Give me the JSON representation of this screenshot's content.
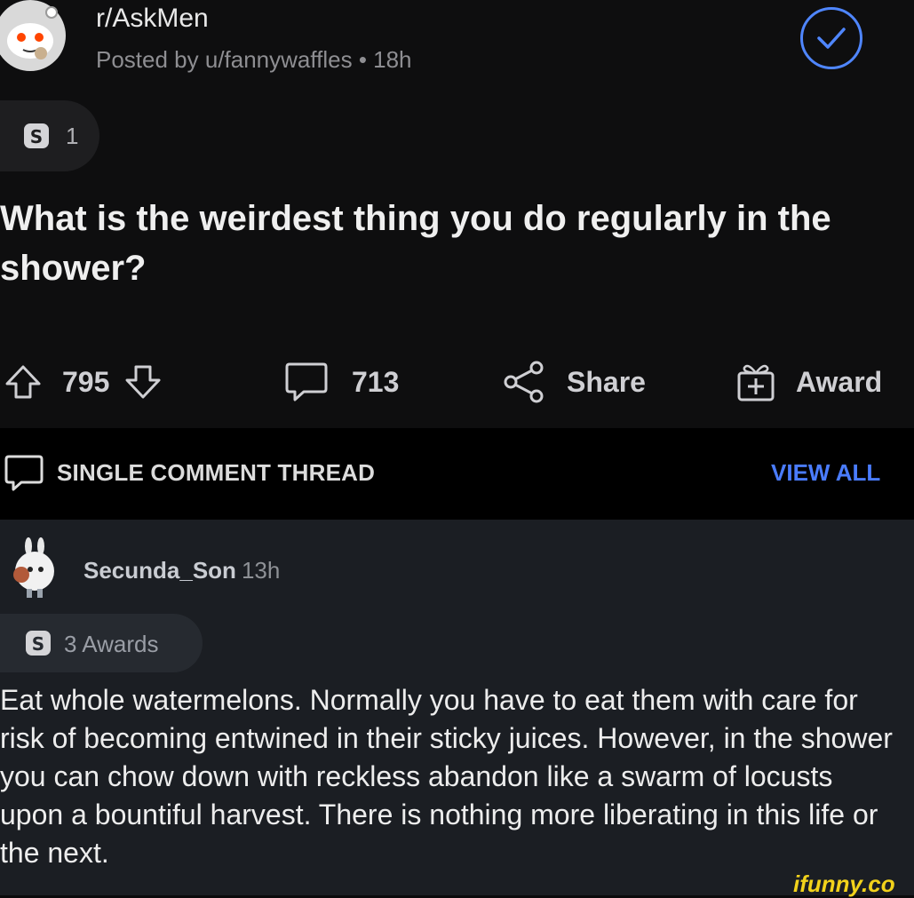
{
  "post": {
    "subreddit": "r/AskMen",
    "meta": "Posted by u/fannywaffles • 18h",
    "award_count": "1",
    "title": "What is the weirdest thing you do regularly in the shower?",
    "upvotes": "795",
    "comments": "713",
    "share_label": "Share",
    "award_label": "Award"
  },
  "thread": {
    "label": "SINGLE COMMENT THREAD",
    "view_all": "VIEW ALL"
  },
  "comment": {
    "username": "Secunda_Son",
    "time": "13h",
    "awards": "3 Awards",
    "body": "Eat whole watermelons. Normally you have to eat them with care for risk of becoming entwined in their sticky juices. However, in the shower you can chow down with reckless abandon like a swarm of locusts upon a bountiful harvest. There is nothing more liberating in this life or the next."
  },
  "watermark": "ifunny.co",
  "colors": {
    "accent": "#4a7cff",
    "background": "#0e0e0f",
    "comment_bg": "#1b1e23",
    "watermark": "#f2d21b"
  },
  "icons": [
    "snoo-avatar",
    "check-circle-icon",
    "coin-icon",
    "upvote-icon",
    "downvote-icon",
    "comment-icon",
    "share-icon",
    "award-icon",
    "bunny-avatar"
  ]
}
